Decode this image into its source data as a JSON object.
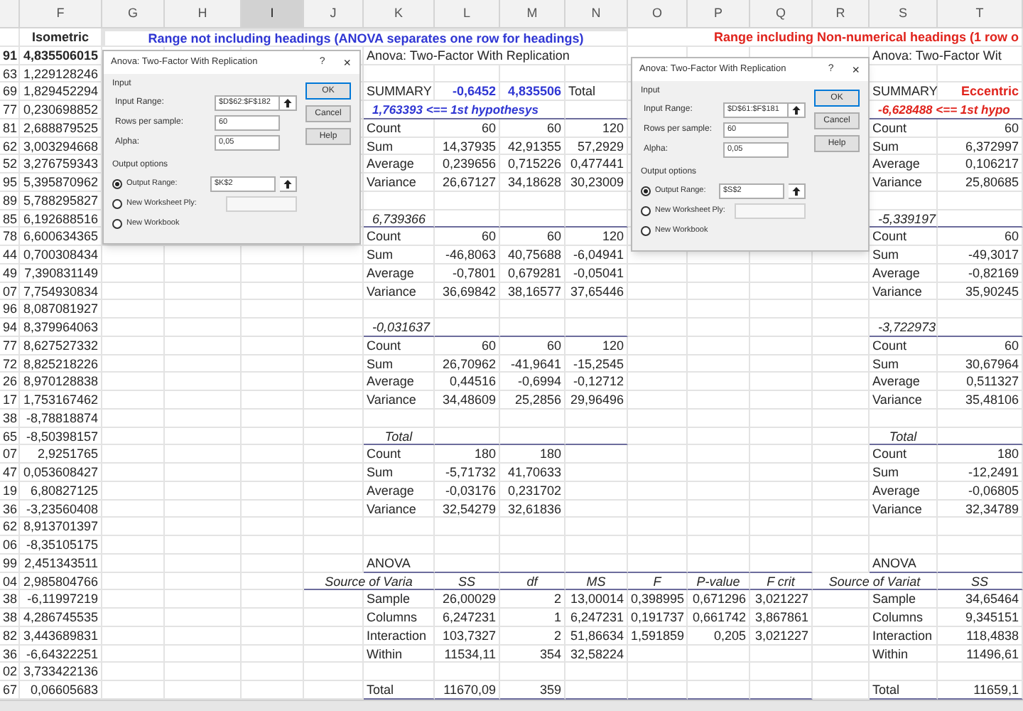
{
  "column_headers": [
    {
      "label": "F",
      "selected": false
    },
    {
      "label": "G",
      "selected": false
    },
    {
      "label": "H",
      "selected": false
    },
    {
      "label": "I",
      "selected": true
    },
    {
      "label": "J",
      "selected": false
    },
    {
      "label": "K",
      "selected": false
    },
    {
      "label": "L",
      "selected": false
    },
    {
      "label": "M",
      "selected": false
    },
    {
      "label": "N",
      "selected": false
    },
    {
      "label": "O",
      "selected": false
    },
    {
      "label": "P",
      "selected": false
    },
    {
      "label": "Q",
      "selected": false
    },
    {
      "label": "R",
      "selected": false
    },
    {
      "label": "S",
      "selected": false
    },
    {
      "label": "T",
      "selected": false
    }
  ],
  "column_f": {
    "heading": "Isometric",
    "rows": [
      {
        "column_1": "91",
        "value": "4,835506015",
        "highlighted": true
      },
      {
        "column_1": "63",
        "value": "1,229128246",
        "highlighted": false
      },
      {
        "column_1": "69",
        "value": "1,829452294",
        "highlighted": false
      },
      {
        "column_1": "77",
        "value": "0,230698852",
        "highlighted": false
      },
      {
        "column_1": "81",
        "value": "2,688879525",
        "highlighted": false
      },
      {
        "column_1": "62",
        "value": "3,003294668",
        "highlighted": false
      },
      {
        "column_1": "52",
        "value": "3,276759343",
        "highlighted": false
      },
      {
        "column_1": "95",
        "value": "5,395870962",
        "highlighted": false
      },
      {
        "column_1": "89",
        "value": "5,788295827",
        "highlighted": false
      },
      {
        "column_1": "85",
        "value": "6,192688516",
        "highlighted": false
      },
      {
        "column_1": "78",
        "value": "6,600634365",
        "highlighted": false
      },
      {
        "column_1": "44",
        "value": "0,700308434",
        "highlighted": false
      },
      {
        "column_1": "49",
        "value": "7,390831149",
        "highlighted": false
      },
      {
        "column_1": "07",
        "value": "7,754930834",
        "highlighted": false
      },
      {
        "column_1": "96",
        "value": "8,087081927",
        "highlighted": false
      },
      {
        "column_1": "94",
        "value": "8,379964063",
        "highlighted": false
      },
      {
        "column_1": "77",
        "value": "8,627527332",
        "highlighted": false
      },
      {
        "column_1": "72",
        "value": "8,825218226",
        "highlighted": false
      },
      {
        "column_1": "26",
        "value": "8,970128838",
        "highlighted": false
      },
      {
        "column_1": "17",
        "value": "1,753167462",
        "highlighted": false
      },
      {
        "column_1": "38",
        "value": "-8,78818874",
        "highlighted": false
      },
      {
        "column_1": "65",
        "value": "-8,50398157",
        "highlighted": false
      },
      {
        "column_1": "07",
        "value": "2,9251765",
        "highlighted": false
      },
      {
        "column_1": "47",
        "value": "0,053608427",
        "highlighted": false
      },
      {
        "column_1": "19",
        "value": "6,80827125",
        "highlighted": false
      },
      {
        "column_1": "36",
        "value": "-3,23560408",
        "highlighted": false
      },
      {
        "column_1": "62",
        "value": "8,913701397",
        "highlighted": false
      },
      {
        "column_1": "06",
        "value": "-8,35105175",
        "highlighted": false
      },
      {
        "column_1": "99",
        "value": "2,451343511",
        "highlighted": false
      },
      {
        "column_1": "04",
        "value": "2,985804766",
        "highlighted": false
      },
      {
        "column_1": "38",
        "value": "-6,11997219",
        "highlighted": false
      },
      {
        "column_1": "38",
        "value": "4,286745535",
        "highlighted": false
      },
      {
        "column_1": "82",
        "value": "3,443689831",
        "highlighted": false
      },
      {
        "column_1": "36",
        "value": "-6,64322251",
        "highlighted": false
      },
      {
        "column_1": "02",
        "value": "3,733422136",
        "highlighted": false
      },
      {
        "column_1": "67",
        "value": "0,06605683",
        "highlighted": false
      }
    ]
  },
  "blocks": [
    {
      "color": "#2f36d3",
      "note": {
        "text": "Range not including headings (ANOVA separates one row for headings)",
        "selected": true
      },
      "title": "Anova: Two-Factor With Replication",
      "summary": {
        "label": "SUMMARY",
        "headers": [
          {
            "text": "-0,6452",
            "highlighted": true
          },
          {
            "text": "4,835506",
            "highlighted": true
          },
          {
            "text": "Total",
            "highlighted": false
          }
        ]
      },
      "groups": [
        {
          "kind": "hypothesis",
          "heading": "1,763393 <== 1st hypothesys",
          "rows": [
            {
              "label": "Count",
              "values": [
                "60",
                "60",
                "120"
              ]
            },
            {
              "label": "Sum",
              "values": [
                "14,37935",
                "42,91355",
                "57,2929"
              ]
            },
            {
              "label": "Average",
              "values": [
                "0,239656",
                "0,715226",
                "0,477441"
              ]
            },
            {
              "label": "Variance",
              "values": [
                "26,67127",
                "34,18628",
                "30,23009"
              ]
            }
          ]
        },
        {
          "kind": "group",
          "heading": "6,739366",
          "rows": [
            {
              "label": "Count",
              "values": [
                "60",
                "60",
                "120"
              ]
            },
            {
              "label": "Sum",
              "values": [
                "-46,8063",
                "40,75688",
                "-6,04941"
              ]
            },
            {
              "label": "Average",
              "values": [
                "-0,7801",
                "0,679281",
                "-0,05041"
              ]
            },
            {
              "label": "Variance",
              "values": [
                "36,69842",
                "38,16577",
                "37,65446"
              ]
            }
          ]
        },
        {
          "kind": "group",
          "heading": "-0,031637",
          "rows": [
            {
              "label": "Count",
              "values": [
                "60",
                "60",
                "120"
              ]
            },
            {
              "label": "Sum",
              "values": [
                "26,70962",
                "-41,9641",
                "-15,2545"
              ]
            },
            {
              "label": "Average",
              "values": [
                "0,44516",
                "-0,6994",
                "-0,12712"
              ]
            },
            {
              "label": "Variance",
              "values": [
                "34,48609",
                "25,2856",
                "29,96496"
              ]
            }
          ]
        },
        {
          "kind": "total",
          "heading": "Total",
          "rows": [
            {
              "label": "Count",
              "values": [
                "180",
                "180"
              ]
            },
            {
              "label": "Sum",
              "values": [
                "-5,71732",
                "41,70633"
              ]
            },
            {
              "label": "Average",
              "values": [
                "-0,03176",
                "0,231702"
              ]
            },
            {
              "label": "Variance",
              "values": [
                "32,54279",
                "32,61836"
              ]
            }
          ]
        }
      ],
      "anova": {
        "title": "ANOVA",
        "columns": [
          "Source of Varia",
          "SS",
          "df",
          "MS",
          "F",
          "P-value",
          "F crit"
        ],
        "rows": [
          {
            "kind": "source",
            "cells": [
              "Sample",
              "26,00029",
              "2",
              "13,00014",
              "0,398995",
              "0,671296",
              "3,021227"
            ]
          },
          {
            "kind": "source",
            "cells": [
              "Columns",
              "6,247231",
              "1",
              "6,247231",
              "0,191737",
              "0,661742",
              "3,867861"
            ]
          },
          {
            "kind": "source",
            "cells": [
              "Interaction",
              "103,7327",
              "2",
              "51,86634",
              "1,591859",
              "0,205",
              "3,021227"
            ]
          },
          {
            "kind": "source",
            "cells": [
              "Within",
              "11534,11",
              "354",
              "32,58224"
            ]
          },
          {
            "kind": "total",
            "cells": [
              "Total",
              "11670,09",
              "359"
            ]
          }
        ]
      }
    },
    {
      "color": "#e0231c",
      "note": {
        "text": "Range including Non-numerical headings (1 row o",
        "selected": false
      },
      "title": "Anova: Two-Factor Wit",
      "summary": {
        "label": "SUMMARY",
        "headers": [
          {
            "text": "Eccentric",
            "highlighted": true
          }
        ]
      },
      "groups": [
        {
          "kind": "hypothesis",
          "heading": "-6,628488 <== 1st hypo",
          "rows": [
            {
              "label": "Count",
              "values": [
                "60"
              ]
            },
            {
              "label": "Sum",
              "values": [
                "6,372997"
              ]
            },
            {
              "label": "Average",
              "values": [
                "0,106217"
              ]
            },
            {
              "label": "Variance",
              "values": [
                "25,80685"
              ]
            }
          ]
        },
        {
          "kind": "group",
          "heading": "-5,339197",
          "rows": [
            {
              "label": "Count",
              "values": [
                "60"
              ]
            },
            {
              "label": "Sum",
              "values": [
                "-49,3017"
              ]
            },
            {
              "label": "Average",
              "values": [
                "-0,82169"
              ]
            },
            {
              "label": "Variance",
              "values": [
                "35,90245"
              ]
            }
          ]
        },
        {
          "kind": "group",
          "heading": "-3,722973",
          "rows": [
            {
              "label": "Count",
              "values": [
                "60"
              ]
            },
            {
              "label": "Sum",
              "values": [
                "30,67964"
              ]
            },
            {
              "label": "Average",
              "values": [
                "0,511327"
              ]
            },
            {
              "label": "Variance",
              "values": [
                "35,48106"
              ]
            }
          ]
        },
        {
          "kind": "total",
          "heading": "Total",
          "rows": [
            {
              "label": "Count",
              "values": [
                "180"
              ]
            },
            {
              "label": "Sum",
              "values": [
                "-12,2491"
              ]
            },
            {
              "label": "Average",
              "values": [
                "-0,06805"
              ]
            },
            {
              "label": "Variance",
              "values": [
                "32,34789"
              ]
            }
          ]
        }
      ],
      "anova": {
        "title": "ANOVA",
        "columns": [
          "Source of Variat",
          "SS"
        ],
        "rows": [
          {
            "kind": "source",
            "cells": [
              "Sample",
              "34,65464"
            ]
          },
          {
            "kind": "source",
            "cells": [
              "Columns",
              "9,345151"
            ]
          },
          {
            "kind": "source",
            "cells": [
              "Interaction",
              "118,4838"
            ]
          },
          {
            "kind": "source",
            "cells": [
              "Within",
              "11496,61"
            ]
          },
          {
            "kind": "total",
            "cells": [
              "Total",
              "11659,1"
            ]
          }
        ]
      }
    }
  ],
  "dialogs": [
    {
      "title": "Anova: Two-Factor With Replication",
      "help": "?",
      "close": "×",
      "input_label": "Input",
      "inputs": [
        {
          "label": "Input Range:",
          "value": "$D$62:$F$182",
          "kind": "range"
        },
        {
          "label": "Rows per sample:",
          "value": "60",
          "kind": "text"
        },
        {
          "label": "Alpha:",
          "value": "0,05",
          "kind": "text"
        }
      ],
      "output_label": "Output options",
      "outputs": [
        {
          "label": "Output Range:",
          "selected": true,
          "kind": "range",
          "value": "$K$2"
        },
        {
          "label": "New Worksheet Ply:",
          "selected": false,
          "kind": "field"
        },
        {
          "label": "New Workbook",
          "selected": false,
          "kind": "plain"
        }
      ],
      "buttons": [
        {
          "label": "OK",
          "default": true
        },
        {
          "label": "Cancel",
          "default": false
        },
        {
          "label": "Help",
          "default": false
        }
      ]
    },
    {
      "title": "Anova: Two-Factor With Replication",
      "help": "?",
      "close": "×",
      "input_label": "Input",
      "inputs": [
        {
          "label": "Input Range:",
          "value": "$D$61:$F$181",
          "kind": "range"
        },
        {
          "label": "Rows per sample:",
          "value": "60",
          "kind": "text"
        },
        {
          "label": "Alpha:",
          "value": "0,05",
          "kind": "text"
        }
      ],
      "output_label": "Output options",
      "outputs": [
        {
          "label": "Output Range:",
          "selected": true,
          "kind": "range",
          "value": "$S$2"
        },
        {
          "label": "New Worksheet Ply:",
          "selected": false,
          "kind": "field"
        },
        {
          "label": "New Workbook",
          "selected": false,
          "kind": "plain"
        }
      ],
      "buttons": [
        {
          "label": "OK",
          "default": true
        },
        {
          "label": "Cancel",
          "default": false
        },
        {
          "label": "Help",
          "default": false
        }
      ]
    }
  ]
}
